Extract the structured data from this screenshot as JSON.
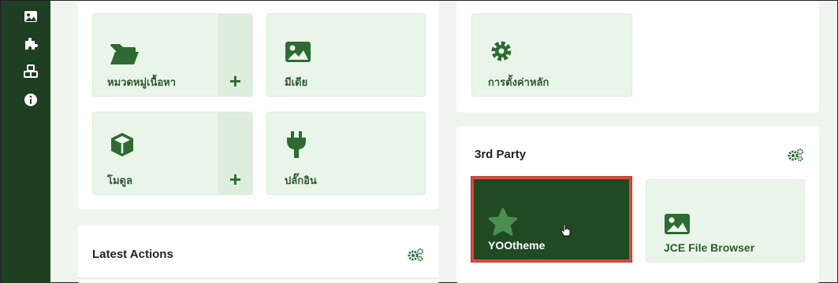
{
  "sidebar": {
    "icons": [
      "image-icon",
      "puzzle-icon",
      "cubes-icon",
      "info-icon"
    ]
  },
  "tiles": {
    "categories": {
      "label": "หมวดหมู่เนื้อหา",
      "add": "+"
    },
    "media": {
      "label": "มีเดีย"
    },
    "modules": {
      "label": "โมดูล",
      "add": "+"
    },
    "plugins": {
      "label": "ปลั๊กอิน"
    },
    "global_config": {
      "label": "การตั้งค่าหลัก"
    }
  },
  "latest_actions": {
    "title": "Latest Actions"
  },
  "third_party": {
    "title": "3rd Party",
    "yootheme": {
      "label": "YOOtheme"
    },
    "jce": {
      "label": "JCE File Browser"
    }
  },
  "colors": {
    "sidebar": "#1f3f22",
    "accent": "#2e6b32",
    "tile_bg": "#eaf5ea",
    "highlight_border": "#e2483d"
  }
}
